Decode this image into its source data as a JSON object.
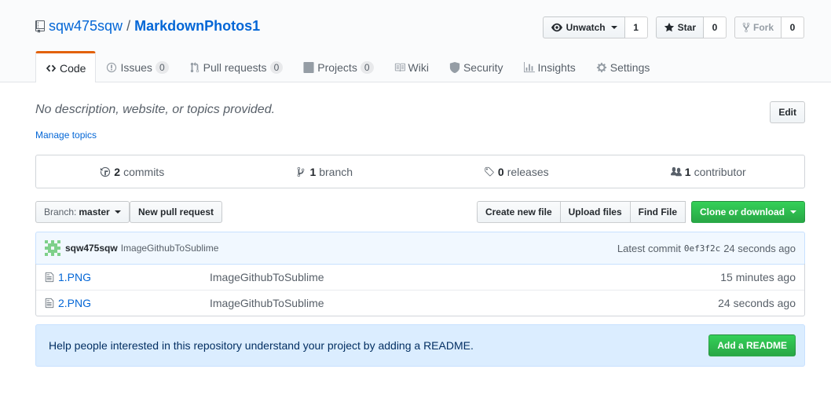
{
  "repo": {
    "owner": "sqw475sqw",
    "separator": "/",
    "name": "MarkdownPhotos1"
  },
  "actions": {
    "watch_label": "Unwatch",
    "watch_count": "1",
    "star_label": "Star",
    "star_count": "0",
    "fork_label": "Fork",
    "fork_count": "0"
  },
  "nav": {
    "code": "Code",
    "issues": "Issues",
    "issues_count": "0",
    "pulls": "Pull requests",
    "pulls_count": "0",
    "projects": "Projects",
    "projects_count": "0",
    "wiki": "Wiki",
    "security": "Security",
    "insights": "Insights",
    "settings": "Settings"
  },
  "description": "No description, website, or topics provided.",
  "edit_label": "Edit",
  "manage_topics": "Manage topics",
  "summary": {
    "commits_num": "2",
    "commits_label": "commits",
    "branch_num": "1",
    "branch_label": "branch",
    "releases_num": "0",
    "releases_label": "releases",
    "contrib_num": "1",
    "contrib_label": "contributor"
  },
  "file_nav": {
    "branch_prefix": "Branch:",
    "branch_name": "master",
    "new_pr": "New pull request",
    "create_file": "Create new file",
    "upload_files": "Upload files",
    "find_file": "Find File",
    "clone": "Clone or download"
  },
  "commit": {
    "author": "sqw475sqw",
    "message": "ImageGithubToSublime",
    "latest_label": "Latest commit",
    "sha": "0ef3f2c",
    "age": "24 seconds ago"
  },
  "files": [
    {
      "name": "1.PNG",
      "message": "ImageGithubToSublime",
      "age": "15 minutes ago"
    },
    {
      "name": "2.PNG",
      "message": "ImageGithubToSublime",
      "age": "24 seconds ago"
    }
  ],
  "readme_prompt": {
    "text": "Help people interested in this repository understand your project by adding a README.",
    "button": "Add a README"
  },
  "colors": {
    "accent_tab": "#e36209",
    "primary_green": "#28a745",
    "link_blue": "#0366d6",
    "avatar_green": "#7ed08a"
  }
}
